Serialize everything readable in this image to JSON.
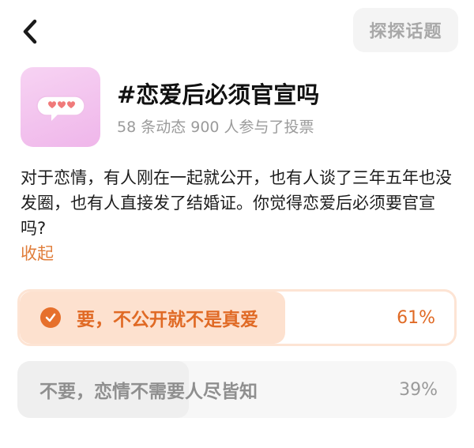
{
  "header": {
    "back_icon": "chevron-left-icon",
    "explore_label": "探探话题"
  },
  "topic": {
    "cover_icon": "speech-bubble-hearts-icon",
    "title": "#恋爱后必须官宣吗",
    "meta": "58 条动态 900 人参与了投票"
  },
  "description": {
    "text": "对于恋情，有人刚在一起就公开，也有人谈了三年五年也没发圈，也有人直接发了结婚证。你觉得恋爱后必须要官宣吗?",
    "collapse_label": "收起"
  },
  "poll": {
    "options": [
      {
        "label": "要，不公开就不是真爱",
        "percent_text": "61%",
        "percent": 61,
        "selected": true
      },
      {
        "label": "不要，恋情不需要人尽皆知",
        "percent_text": "39%",
        "percent": 39,
        "selected": false
      }
    ]
  },
  "colors": {
    "accent": "#e06a25",
    "selected_fill": "#fde1cf",
    "unselected_fill": "#efefef"
  }
}
